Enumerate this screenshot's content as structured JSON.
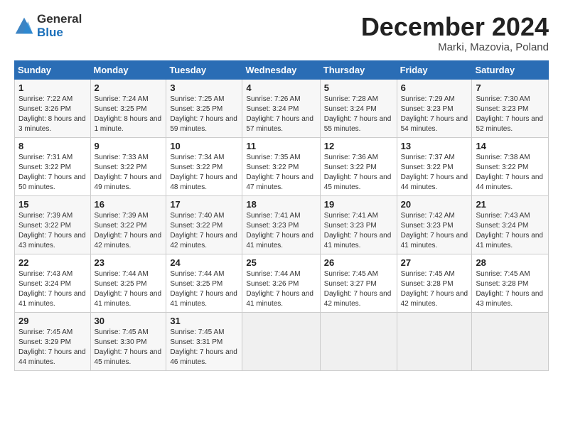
{
  "logo": {
    "general": "General",
    "blue": "Blue"
  },
  "title": "December 2024",
  "subtitle": "Marki, Mazovia, Poland",
  "days_of_week": [
    "Sunday",
    "Monday",
    "Tuesday",
    "Wednesday",
    "Thursday",
    "Friday",
    "Saturday"
  ],
  "weeks": [
    [
      {
        "day": "1",
        "sunrise": "7:22 AM",
        "sunset": "3:26 PM",
        "daylight": "8 hours and 3 minutes."
      },
      {
        "day": "2",
        "sunrise": "7:24 AM",
        "sunset": "3:25 PM",
        "daylight": "8 hours and 1 minute."
      },
      {
        "day": "3",
        "sunrise": "7:25 AM",
        "sunset": "3:25 PM",
        "daylight": "7 hours and 59 minutes."
      },
      {
        "day": "4",
        "sunrise": "7:26 AM",
        "sunset": "3:24 PM",
        "daylight": "7 hours and 57 minutes."
      },
      {
        "day": "5",
        "sunrise": "7:28 AM",
        "sunset": "3:24 PM",
        "daylight": "7 hours and 55 minutes."
      },
      {
        "day": "6",
        "sunrise": "7:29 AM",
        "sunset": "3:23 PM",
        "daylight": "7 hours and 54 minutes."
      },
      {
        "day": "7",
        "sunrise": "7:30 AM",
        "sunset": "3:23 PM",
        "daylight": "7 hours and 52 minutes."
      }
    ],
    [
      {
        "day": "8",
        "sunrise": "7:31 AM",
        "sunset": "3:22 PM",
        "daylight": "7 hours and 50 minutes."
      },
      {
        "day": "9",
        "sunrise": "7:33 AM",
        "sunset": "3:22 PM",
        "daylight": "7 hours and 49 minutes."
      },
      {
        "day": "10",
        "sunrise": "7:34 AM",
        "sunset": "3:22 PM",
        "daylight": "7 hours and 48 minutes."
      },
      {
        "day": "11",
        "sunrise": "7:35 AM",
        "sunset": "3:22 PM",
        "daylight": "7 hours and 47 minutes."
      },
      {
        "day": "12",
        "sunrise": "7:36 AM",
        "sunset": "3:22 PM",
        "daylight": "7 hours and 45 minutes."
      },
      {
        "day": "13",
        "sunrise": "7:37 AM",
        "sunset": "3:22 PM",
        "daylight": "7 hours and 44 minutes."
      },
      {
        "day": "14",
        "sunrise": "7:38 AM",
        "sunset": "3:22 PM",
        "daylight": "7 hours and 44 minutes."
      }
    ],
    [
      {
        "day": "15",
        "sunrise": "7:39 AM",
        "sunset": "3:22 PM",
        "daylight": "7 hours and 43 minutes."
      },
      {
        "day": "16",
        "sunrise": "7:39 AM",
        "sunset": "3:22 PM",
        "daylight": "7 hours and 42 minutes."
      },
      {
        "day": "17",
        "sunrise": "7:40 AM",
        "sunset": "3:22 PM",
        "daylight": "7 hours and 42 minutes."
      },
      {
        "day": "18",
        "sunrise": "7:41 AM",
        "sunset": "3:23 PM",
        "daylight": "7 hours and 41 minutes."
      },
      {
        "day": "19",
        "sunrise": "7:41 AM",
        "sunset": "3:23 PM",
        "daylight": "7 hours and 41 minutes."
      },
      {
        "day": "20",
        "sunrise": "7:42 AM",
        "sunset": "3:23 PM",
        "daylight": "7 hours and 41 minutes."
      },
      {
        "day": "21",
        "sunrise": "7:43 AM",
        "sunset": "3:24 PM",
        "daylight": "7 hours and 41 minutes."
      }
    ],
    [
      {
        "day": "22",
        "sunrise": "7:43 AM",
        "sunset": "3:24 PM",
        "daylight": "7 hours and 41 minutes."
      },
      {
        "day": "23",
        "sunrise": "7:44 AM",
        "sunset": "3:25 PM",
        "daylight": "7 hours and 41 minutes."
      },
      {
        "day": "24",
        "sunrise": "7:44 AM",
        "sunset": "3:25 PM",
        "daylight": "7 hours and 41 minutes."
      },
      {
        "day": "25",
        "sunrise": "7:44 AM",
        "sunset": "3:26 PM",
        "daylight": "7 hours and 41 minutes."
      },
      {
        "day": "26",
        "sunrise": "7:45 AM",
        "sunset": "3:27 PM",
        "daylight": "7 hours and 42 minutes."
      },
      {
        "day": "27",
        "sunrise": "7:45 AM",
        "sunset": "3:28 PM",
        "daylight": "7 hours and 42 minutes."
      },
      {
        "day": "28",
        "sunrise": "7:45 AM",
        "sunset": "3:28 PM",
        "daylight": "7 hours and 43 minutes."
      }
    ],
    [
      {
        "day": "29",
        "sunrise": "7:45 AM",
        "sunset": "3:29 PM",
        "daylight": "7 hours and 44 minutes."
      },
      {
        "day": "30",
        "sunrise": "7:45 AM",
        "sunset": "3:30 PM",
        "daylight": "7 hours and 45 minutes."
      },
      {
        "day": "31",
        "sunrise": "7:45 AM",
        "sunset": "3:31 PM",
        "daylight": "7 hours and 46 minutes."
      },
      null,
      null,
      null,
      null
    ]
  ],
  "labels": {
    "sunrise": "Sunrise:",
    "sunset": "Sunset:",
    "daylight": "Daylight:"
  }
}
